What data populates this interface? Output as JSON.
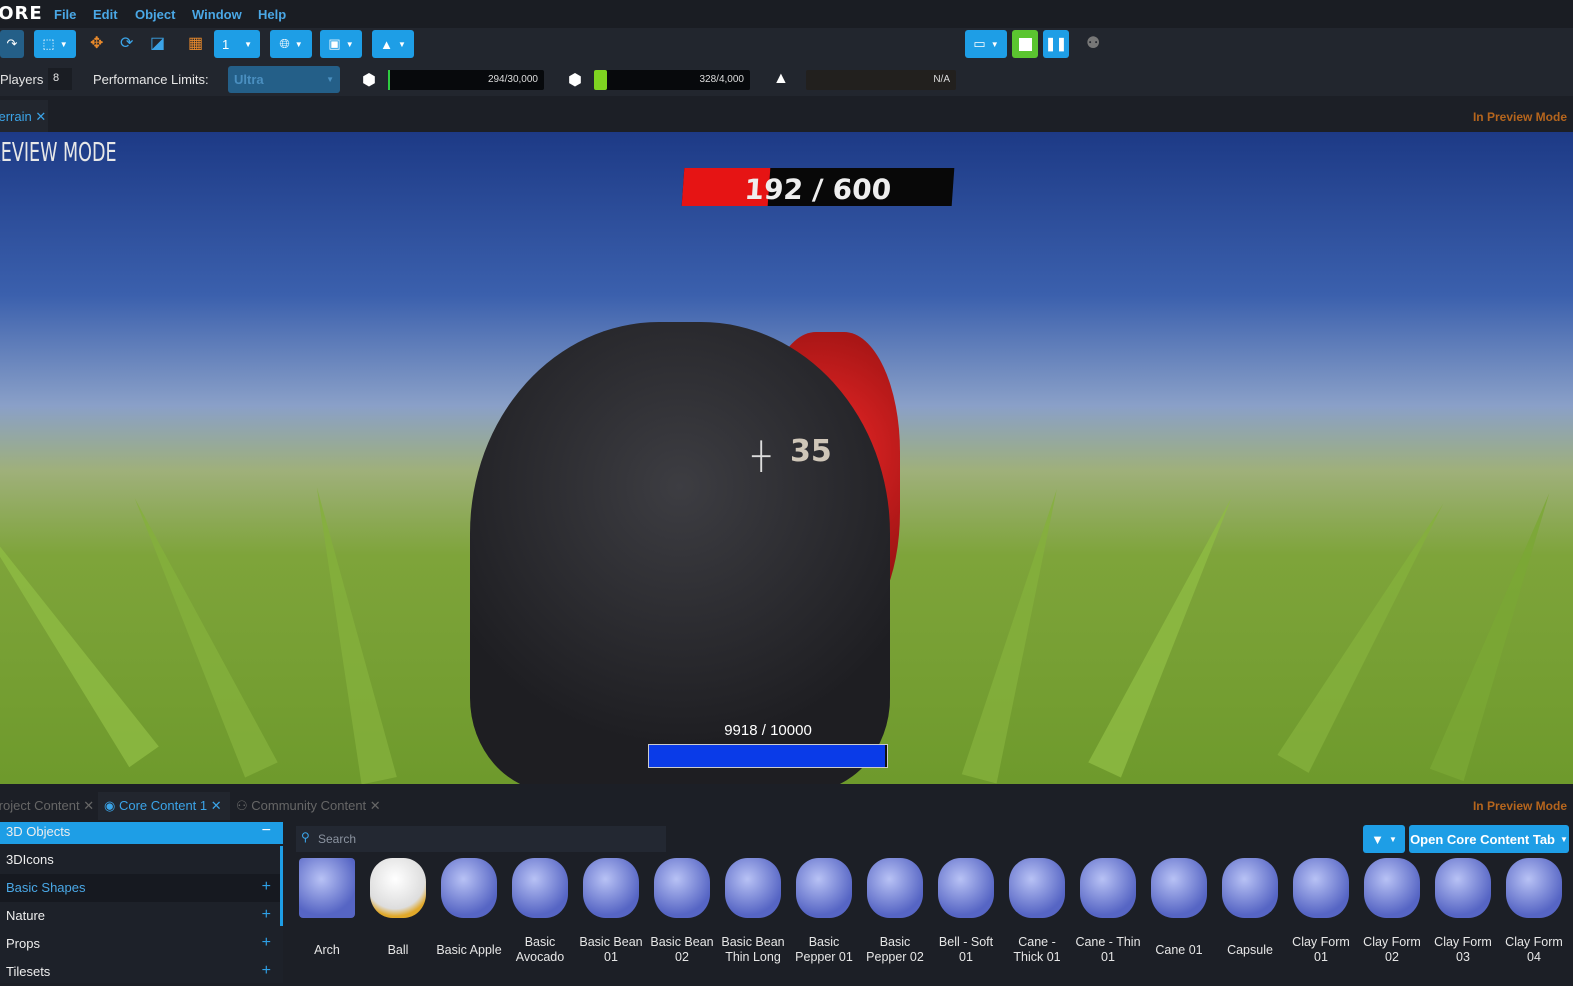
{
  "app": {
    "logo": "CORE"
  },
  "menu": [
    "File",
    "Edit",
    "Object",
    "Window",
    "Help"
  ],
  "toolbar": {
    "grid_count": "1"
  },
  "perf": {
    "players_label": "Players",
    "players": "8",
    "limits_label": "Performance Limits:",
    "limits_value": "Ultra",
    "bars": [
      {
        "value": "294/30,000",
        "fraction": 0.0098,
        "color": "#2ecc40"
      },
      {
        "value": "328/4,000",
        "fraction": 0.082,
        "color": "#7ed321"
      },
      {
        "value": "N/A",
        "fraction": 0,
        "color": "#3a2a1a"
      }
    ]
  },
  "tabs": {
    "viewport_tab": "Terrain",
    "preview_status": "In Preview Mode"
  },
  "viewport": {
    "mode_label": "PREVIEW MODE",
    "enemy_health": "192 / 600",
    "enemy_health_fraction": 0.32,
    "damage_number": "35",
    "player_health": "9918 / 10000",
    "player_health_fraction": 0.9918
  },
  "bottom_tabs": [
    {
      "label": "Project Content"
    },
    {
      "label": "Core Content 1",
      "active": true
    },
    {
      "label": "Community Content"
    }
  ],
  "bottom_status": "In Preview Mode",
  "sidebar": {
    "header": "3D Objects",
    "items": [
      "3DIcons",
      "Basic Shapes",
      "Nature",
      "Props",
      "Tilesets"
    ]
  },
  "search": {
    "placeholder": "Search"
  },
  "open_tab_button": "Open Core Content Tab",
  "items": [
    "Arch",
    "Ball",
    "Basic Apple",
    "Basic Avocado",
    "Basic Bean 01",
    "Basic Bean 02",
    "Basic Bean Thin Long",
    "Basic Pepper 01",
    "Basic Pepper 02",
    "Bell - Soft 01",
    "Cane - Thick 01",
    "Cane - Thin 01",
    "Cane 01",
    "Capsule",
    "Clay Form 01",
    "Clay Form 02",
    "Clay Form 03",
    "Clay Form 04"
  ],
  "colors": {
    "accent": "#1e9ee6",
    "preview": "#b5651d"
  }
}
